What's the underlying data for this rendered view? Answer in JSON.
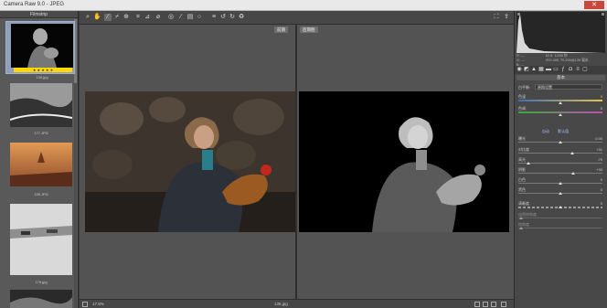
{
  "window": {
    "title": "Camera Raw 9.0 - JPEG",
    "close_glyph": "✕"
  },
  "filmstrip": {
    "header": "Filmstrip",
    "items": [
      {
        "caption": "135.jpg",
        "selected": true,
        "stars": "★ ★ ★ ★ ★"
      },
      {
        "caption": "177.JPG",
        "selected": false
      },
      {
        "caption": "138.JPG",
        "selected": false
      },
      {
        "caption": "179.jpg",
        "selected": false
      },
      {
        "caption": "",
        "selected": false
      }
    ]
  },
  "toolbar": {
    "tools": [
      "zoom-icon",
      "hand-icon",
      "white-balance-icon",
      "color-sampler-icon",
      "targeted-adjust-icon",
      "crop-icon",
      "straighten-icon",
      "spot-removal-icon",
      "redeye-icon",
      "adjustment-brush-icon",
      "graduated-filter-icon",
      "radial-filter-icon",
      "preferences-icon",
      "rotate-ccw-icon",
      "rotate-cw-icon",
      "trash-icon"
    ],
    "right_icons": [
      "fullscreen-icon",
      "export-icon"
    ]
  },
  "canvas": {
    "before_label": "前期",
    "after_label": "后期图"
  },
  "bottombar": {
    "zoom": "17.8%",
    "filename": "135.jpg"
  },
  "histogram": {
    "readout_left": "R: ---\nG: ---\nB: ---",
    "readout_right": "f/2.8  1/250 秒\nISO 400  70-200@135 毫米"
  },
  "panel": {
    "section": "基本",
    "treatment_label": "白平衡:",
    "treatment_value": "原照设置",
    "link_auto": "自动",
    "link_default": "默认值",
    "sliders": [
      {
        "label": "色温",
        "value": "0",
        "kind": "temp"
      },
      {
        "label": "色调",
        "value": "0",
        "kind": "tint"
      },
      {
        "label": "曝光",
        "value": "0.00",
        "kind": "plain"
      },
      {
        "label": "对比度",
        "value": "+31",
        "kind": "plain"
      },
      {
        "label": "高光",
        "value": "-79",
        "kind": "plain"
      },
      {
        "label": "阴影",
        "value": "+30",
        "kind": "plain"
      },
      {
        "label": "白色",
        "value": "0",
        "kind": "plain"
      },
      {
        "label": "黑色",
        "value": "0",
        "kind": "plain"
      },
      {
        "label": "清晰度",
        "value": "0",
        "kind": "plain"
      },
      {
        "label": "自然饱和度",
        "value": "",
        "kind": "plain"
      },
      {
        "label": "饱和度",
        "value": "",
        "kind": "plain"
      }
    ]
  }
}
